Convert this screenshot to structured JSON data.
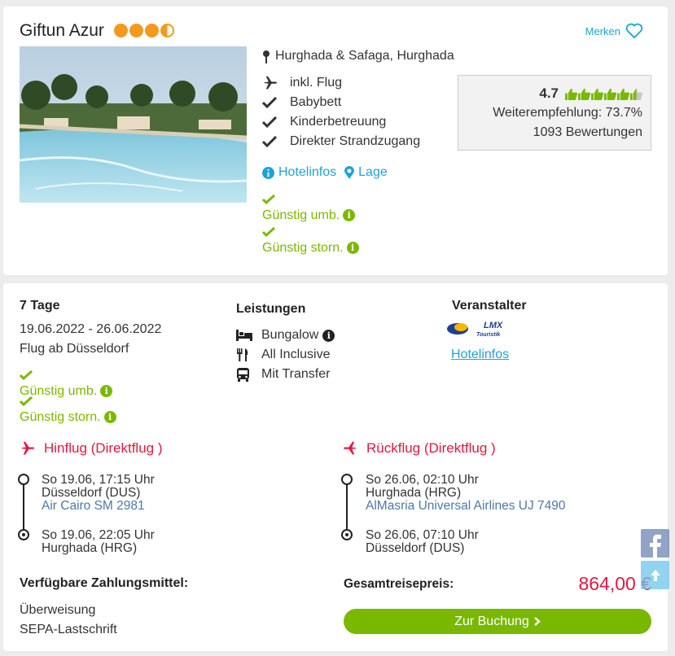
{
  "hotel": {
    "name": "Giftun Azur",
    "merken": "Merken",
    "location": "Hurghada & Safaga, Hurghada",
    "features": [
      "inkl. Flug",
      "Babybett",
      "Kinderbetreuung",
      "Direkter Strandzugang"
    ],
    "links": {
      "hotelinfos": "Hotelinfos",
      "lage": "Lage"
    },
    "conditions": [
      "Günstig umb.",
      "Günstig storn."
    ],
    "stars_rating": 3.5,
    "colors": {
      "accent": "#1fa3d6",
      "green": "#7ab800",
      "star": "#f39a1e",
      "red": "#e5173f"
    }
  },
  "rating": {
    "score": "4.7",
    "recommendation": "Weiterempfehlung: 73.7%",
    "reviews": "1093 Bewertungen",
    "thumbs_filled": 5.5,
    "thumbs_total": 6
  },
  "offer": {
    "duration": "7 Tage",
    "dates": "19.06.2022 - 26.06.2022",
    "flight_from": "Flug ab Düsseldorf",
    "conditions": [
      "Günstig umb.",
      "Günstig storn."
    ],
    "services_title": "Leistungen",
    "services": [
      {
        "icon": "bed-icon",
        "label": "Bungalow"
      },
      {
        "icon": "cutlery-icon",
        "label": "All Inclusive"
      },
      {
        "icon": "bus-icon",
        "label": "Mit Transfer"
      }
    ],
    "operator_title": "Veranstalter",
    "operator_logo_text": "LMX Touristik",
    "operator_link": "Hotelinfos"
  },
  "flights": {
    "outbound": {
      "title": "Hinflug (Direktflug )",
      "dep_time": "So 19.06, 17:15 Uhr",
      "dep_airport": "Düsseldorf (DUS)",
      "airline": "Air Cairo SM 2981",
      "arr_time": "So 19.06, 22:05 Uhr",
      "arr_airport": "Hurghada (HRG)"
    },
    "return": {
      "title": "Rückflug (Direktflug )",
      "dep_time": "So 26.06, 02:10 Uhr",
      "dep_airport": "Hurghada (HRG)",
      "airline": "AlMasria Universal Airlines UJ 7490",
      "arr_time": "So 26.06, 07:10 Uhr",
      "arr_airport": "Düsseldorf (DUS)"
    }
  },
  "payment": {
    "title": "Verfügbare Zahlungsmittel:",
    "methods": [
      "Überweisung",
      "SEPA-Lastschrift"
    ]
  },
  "price": {
    "label": "Gesamtreisepreis:",
    "value": "864,00 €"
  },
  "booking_button": "Zur Buchung"
}
